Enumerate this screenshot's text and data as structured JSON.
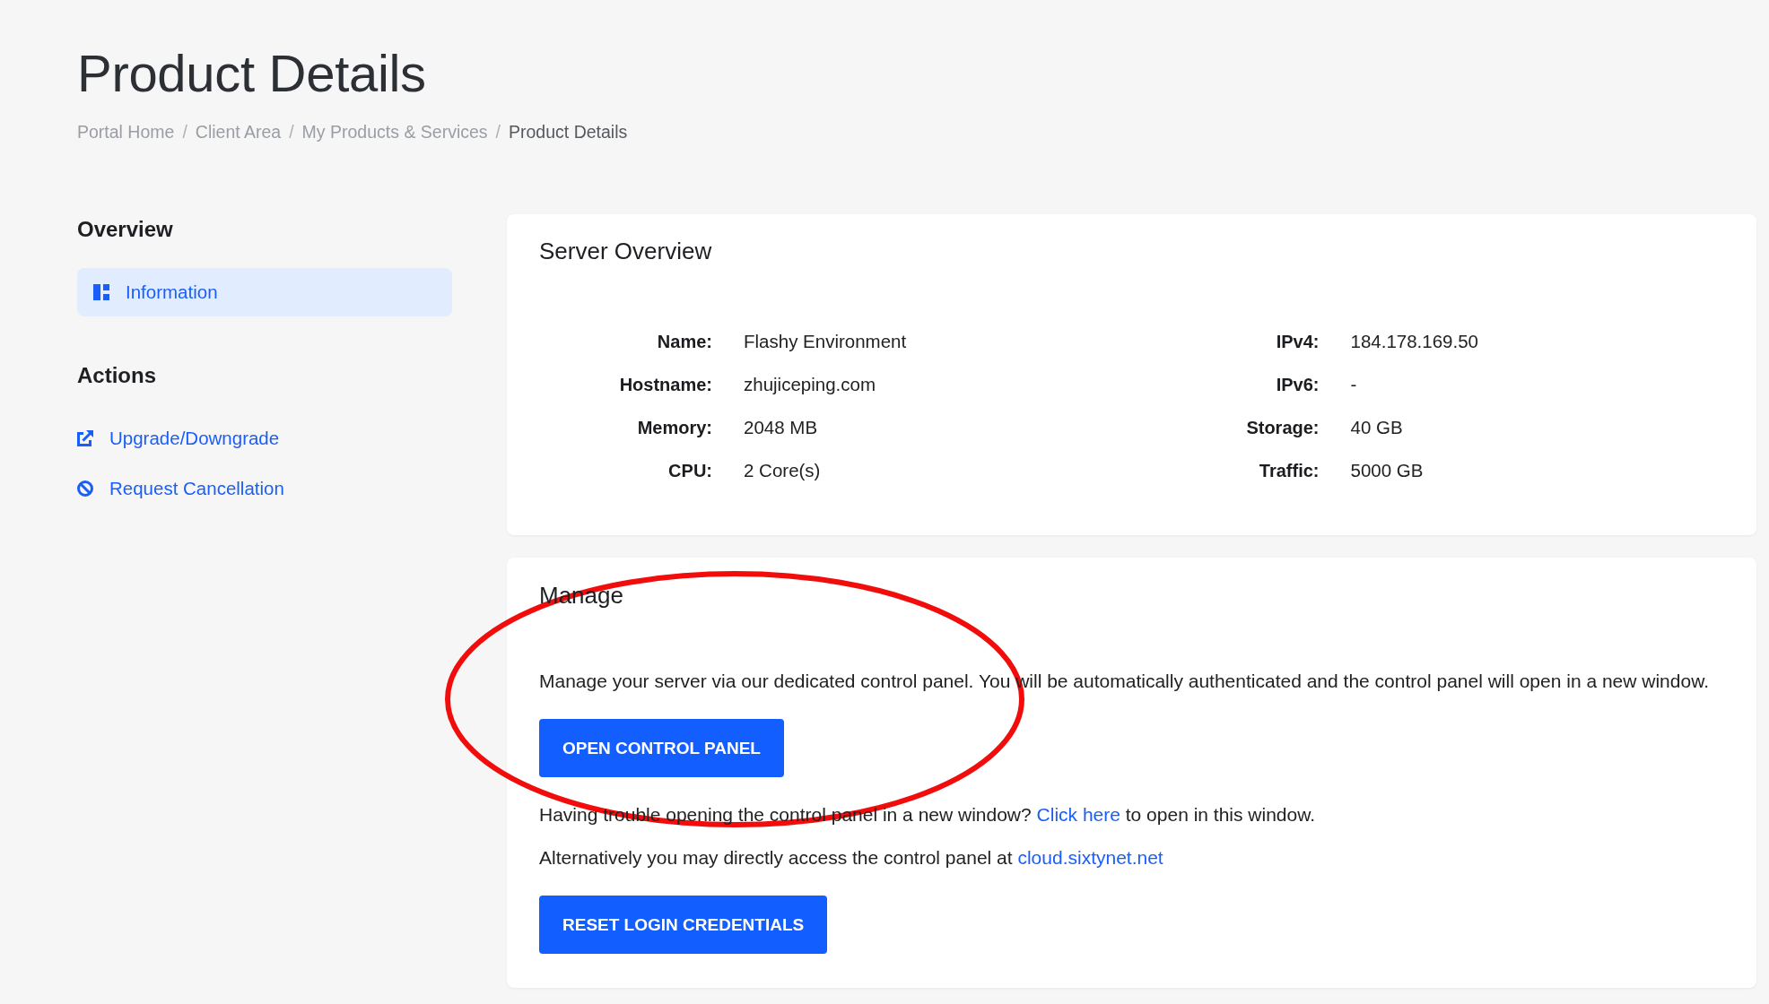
{
  "page": {
    "title": "Product Details"
  },
  "breadcrumb": {
    "items": [
      {
        "label": "Portal Home",
        "selected": false
      },
      {
        "separator": "/",
        "label": "Client Area",
        "selected": false
      },
      {
        "separator": "/",
        "label": "My Products & Services",
        "selected": false
      },
      {
        "separator": "/",
        "label": "Product Details",
        "selected": true
      }
    ]
  },
  "sidebar": {
    "sections": [
      {
        "kind": "menu",
        "heading": "Overview",
        "items": [
          {
            "label": "Information",
            "selected": true
          }
        ]
      },
      {
        "kind": "links",
        "heading": "Actions",
        "items": [
          {
            "label": "Upgrade/Downgrade"
          },
          {
            "label": "Request Cancellation"
          }
        ]
      }
    ]
  },
  "server_overview": {
    "title": "Server Overview",
    "columns": [
      [
        {
          "label": "Name:",
          "value": "Flashy Environment"
        },
        {
          "label": "Hostname:",
          "value": "zhujiceping.com"
        },
        {
          "label": "Memory:",
          "value": "2048 MB"
        },
        {
          "label": "CPU:",
          "value": "2 Core(s)"
        }
      ],
      [
        {
          "label": "IPv4:",
          "value": "184.178.169.50"
        },
        {
          "label": "IPv6:",
          "value": "-"
        },
        {
          "label": "Storage:",
          "value": "40 GB"
        },
        {
          "label": "Traffic:",
          "value": "5000 GB"
        }
      ]
    ]
  },
  "manage": {
    "title": "Manage",
    "blocks": [
      {
        "kind": "text",
        "text": "Manage your server via our dedicated control panel. You will be automatically authenticated and the control panel will open in a new window."
      },
      {
        "kind": "button",
        "label": "OPEN CONTROL PANEL"
      },
      {
        "kind": "link_text",
        "before": "Having trouble opening the control panel in a new window?",
        "link": "Click here",
        "after": "to open in this window."
      },
      {
        "kind": "link_text",
        "before": "Alternatively you may directly access the control panel at",
        "link": "cloud.sixtynet.net"
      },
      {
        "kind": "button",
        "label": "RESET LOGIN CREDENTIALS"
      }
    ],
    "annotations": [
      {
        "kind": "ellipse"
      }
    ]
  }
}
